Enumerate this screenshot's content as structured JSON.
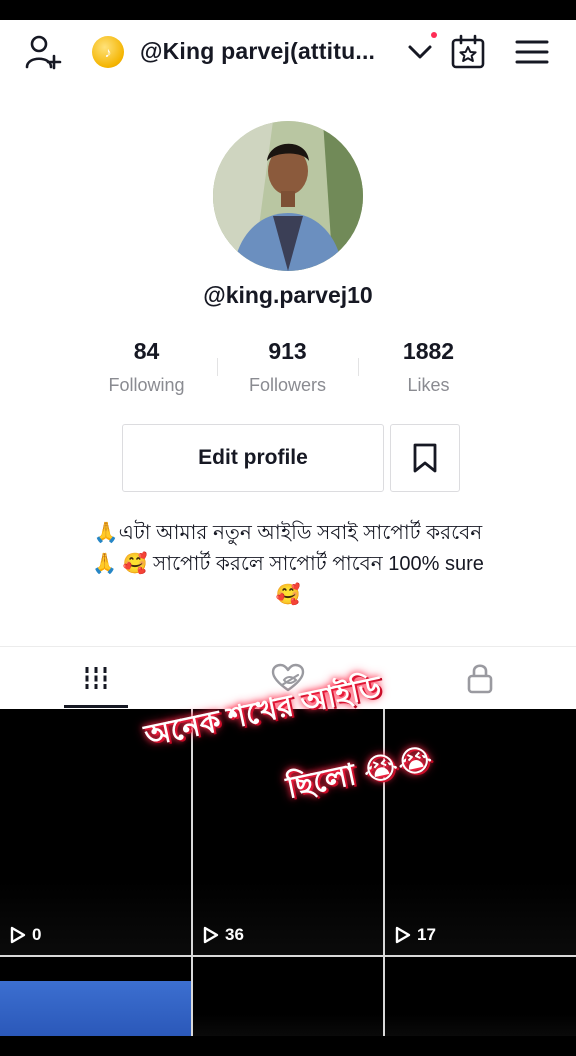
{
  "header": {
    "account_name": "@King parvej(attitu...",
    "icons": [
      "add-user-icon",
      "coin-icon",
      "chevron-down-icon",
      "calendar-star-icon",
      "menu-icon"
    ],
    "notification_dot_color": "#fe2c55"
  },
  "profile": {
    "username": "@king.parvej10",
    "avatar": "profile-photo"
  },
  "stats": [
    {
      "value": "84",
      "label": "Following"
    },
    {
      "value": "913",
      "label": "Followers"
    },
    {
      "value": "1882",
      "label": "Likes"
    }
  ],
  "actions": {
    "edit_profile_label": "Edit profile",
    "bookmark_icon": "bookmark-icon"
  },
  "bio": {
    "line1": "🙏এটা আমার নতুন আইডি সবাই সাপোর্ট করবেন",
    "line2": "🙏 🥰 সাপোর্ট করলে সাপোর্ট পাবেন 100% sure",
    "line3": "🥰"
  },
  "tabs": [
    {
      "name": "videos",
      "icon": "grid-icon",
      "selected": true
    },
    {
      "name": "liked",
      "icon": "hidden-heart-icon",
      "selected": false
    },
    {
      "name": "private",
      "icon": "lock-icon",
      "selected": false
    }
  ],
  "videos": [
    {
      "views": "0"
    },
    {
      "views": "36"
    },
    {
      "views": "17"
    }
  ],
  "overlay": {
    "line1": "অনেক শখের আইডি",
    "line2": "ছিলো 😭😭"
  }
}
